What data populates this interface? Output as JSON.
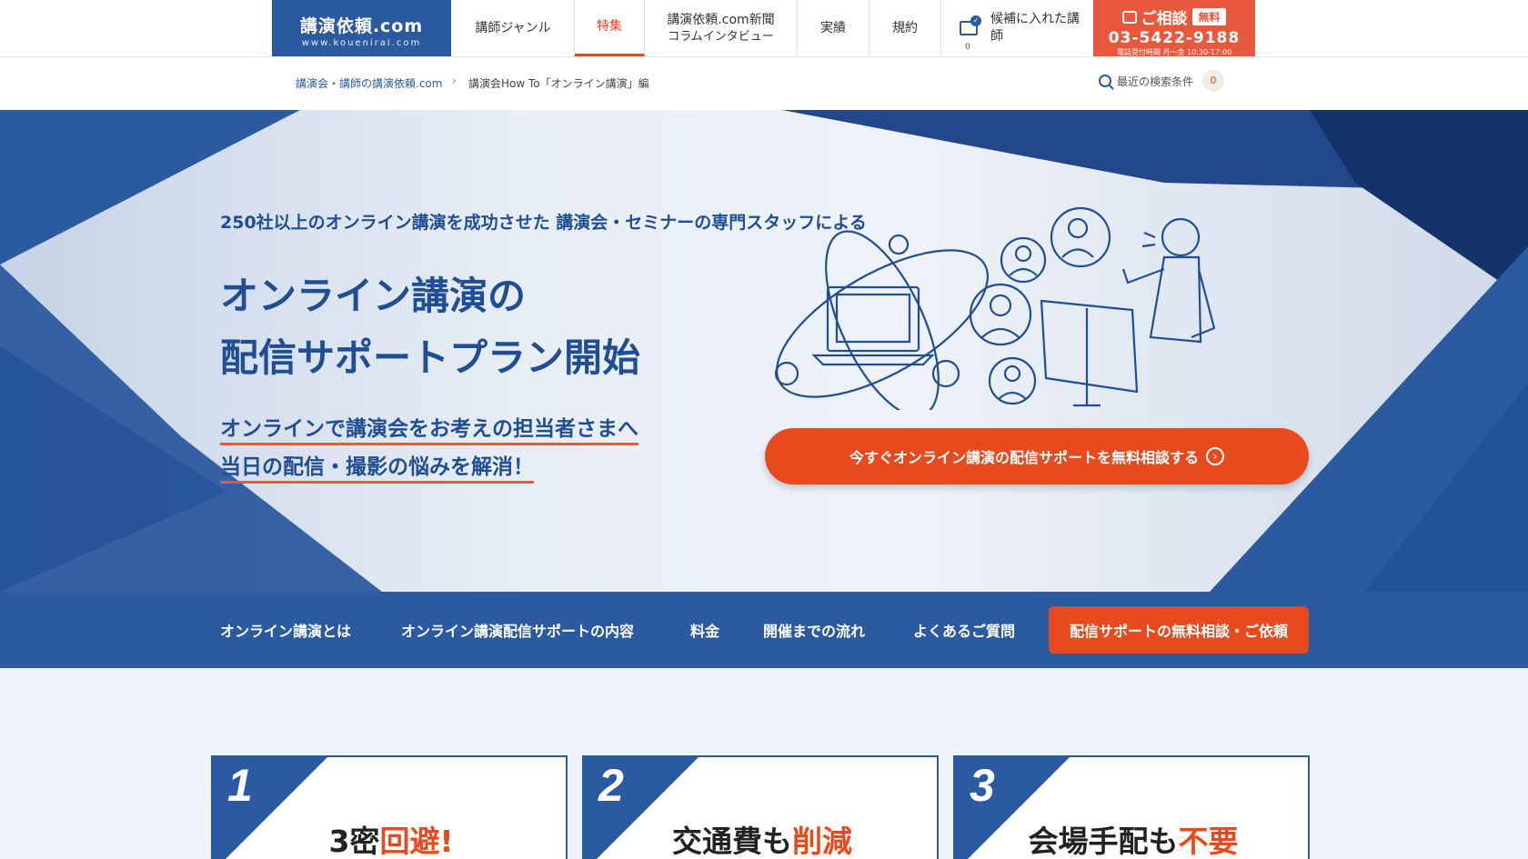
{
  "header": {
    "logo_main": "講演依頼.com",
    "logo_sub": "www.kouenirai.com",
    "nav": [
      {
        "label": "講師ジャンル"
      },
      {
        "label": "特集"
      },
      {
        "label": "講演依頼.com新聞",
        "label2": "コラムインタビュー"
      },
      {
        "label": "実績"
      },
      {
        "label": "規約"
      }
    ],
    "candidates_label": "候補に入れた講師",
    "candidates_count": "0",
    "consult_label": "ご相談",
    "consult_free": "無料",
    "phone": "03-5422-9188",
    "hours": "電話受付時間 月〜金 10:30-17:00"
  },
  "breadcrumb": {
    "home": "講演会・講師の講演依頼.com",
    "current": "講演会How To「オンライン講演」編"
  },
  "recent_search": {
    "label": "最近の検索条件",
    "count": "0"
  },
  "hero": {
    "subheading": "250社以上のオンライン講演を成功させた 講演会・セミナーの専門スタッフによる",
    "title_line1": "オンライン講演の",
    "title_line2": "配信サポートプラン開始",
    "lead_line1": "オンラインで講演会をお考えの担当者さまへ",
    "lead_line2": "当日の配信・撮影の悩みを解消！",
    "cta": "今すぐオンライン講演の配信サポートを無料相談する"
  },
  "section_nav": {
    "items": [
      "オンライン講演とは",
      "オンライン講演配信サポートの内容",
      "料金",
      "開催までの流れ",
      "よくあるご質問"
    ],
    "cta": "配信サポートの無料相談・ご依頼"
  },
  "features": [
    {
      "num": "1",
      "text": "3密",
      "highlight": "回避!"
    },
    {
      "num": "2",
      "text": "交通費も",
      "highlight": "削減"
    },
    {
      "num": "3",
      "text": "会場手配も",
      "highlight": "不要"
    }
  ],
  "colors": {
    "brand_blue": "#2c5aa0",
    "accent_orange": "#e8491d"
  }
}
